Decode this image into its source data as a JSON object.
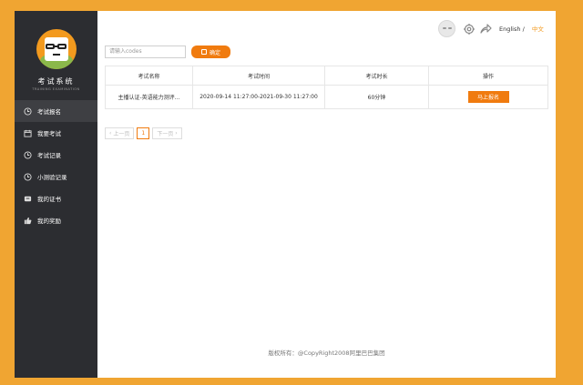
{
  "brand": {
    "title": "考试系统",
    "subtitle": "TRAINING EXAMINATION"
  },
  "sidebar": {
    "items": [
      {
        "label": "考试报名",
        "icon": "clock-icon",
        "active": true
      },
      {
        "label": "我要考试",
        "icon": "calendar-icon",
        "active": false
      },
      {
        "label": "考试记录",
        "icon": "clock-icon",
        "active": false
      },
      {
        "label": "小测验记录",
        "icon": "clock-icon",
        "active": false
      },
      {
        "label": "我的证书",
        "icon": "certificate-icon",
        "active": false
      },
      {
        "label": "我的奖励",
        "icon": "thumbs-up-icon",
        "active": false
      }
    ]
  },
  "header": {
    "lang_en": "English",
    "lang_sep": "/",
    "lang_zh": "中文"
  },
  "search": {
    "placeholder": "请输入codes",
    "button_label": "确定"
  },
  "table": {
    "headers": [
      "考试名称",
      "考试时间",
      "考试时长",
      "操作"
    ],
    "rows": [
      {
        "name": "主播认证-英语能力测评...",
        "time": "2020-09-14 11:27:00-2021-09-30 11:27:00",
        "duration": "60分钟",
        "action": "马上报名"
      }
    ]
  },
  "pagination": {
    "prev": "上一页",
    "current": "1",
    "next": "下一页"
  },
  "footer": {
    "copyright": "版权所有：@CopyRight2008阿里巴巴集团"
  },
  "colors": {
    "accent": "#f07b0f",
    "sidebar_bg": "#2c2d31",
    "outer_bg": "#f0a532"
  }
}
